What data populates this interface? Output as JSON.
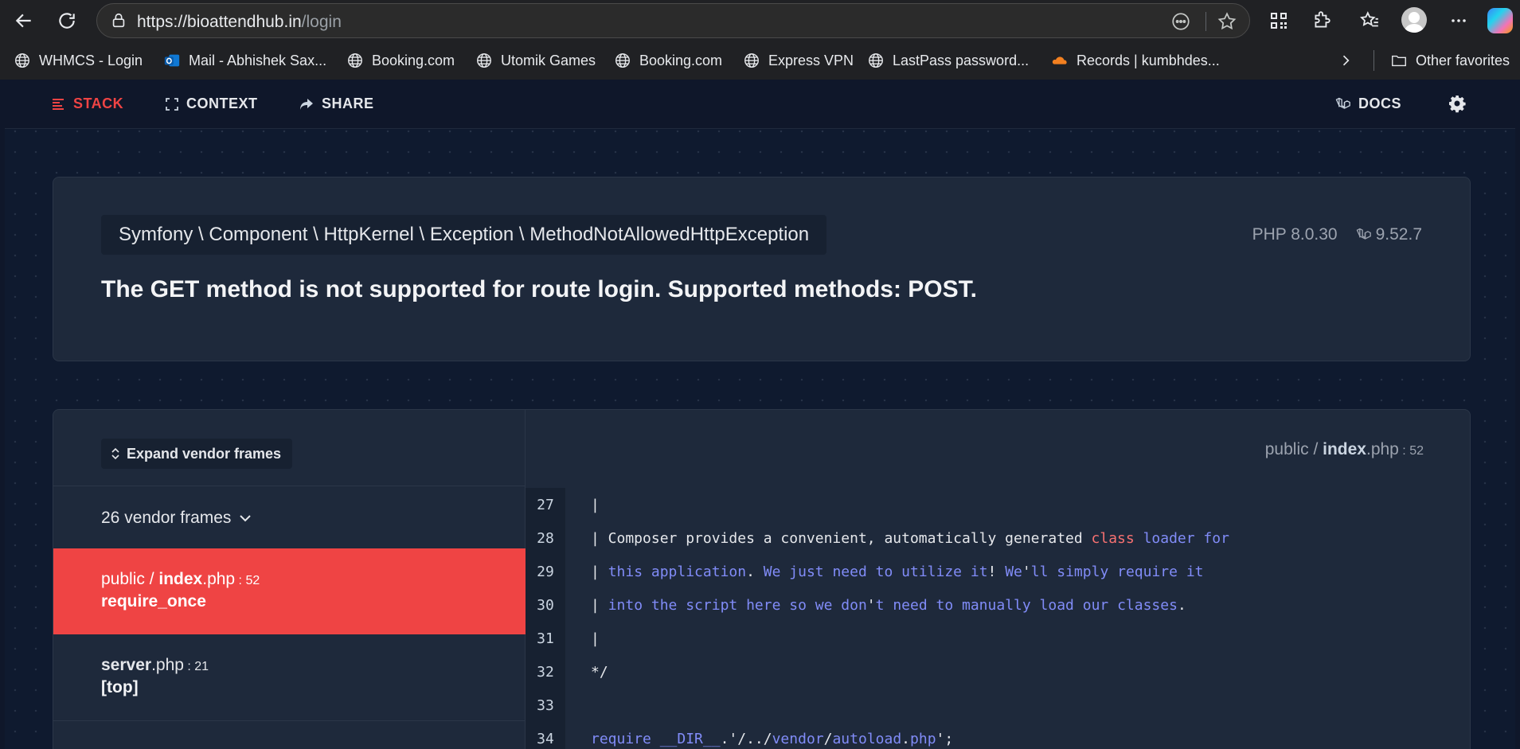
{
  "browser": {
    "url_host": "https://bioattendhub.in",
    "url_path": "/login",
    "bookmarks": [
      {
        "label": "WHMCS - Login",
        "icon": "globe-icon"
      },
      {
        "label": "Mail - Abhishek Sax...",
        "icon": "outlook-icon"
      },
      {
        "label": "Booking.com",
        "icon": "globe-icon"
      },
      {
        "label": "Utomik Games",
        "icon": "globe-icon"
      },
      {
        "label": "Booking.com",
        "icon": "globe-icon"
      },
      {
        "label": "Express VPN",
        "icon": "globe-icon"
      },
      {
        "label": "LastPass password...",
        "icon": "globe-icon"
      },
      {
        "label": "Records | kumbhdes...",
        "icon": "cloudflare-icon"
      }
    ],
    "other_favorites": "Other favorites"
  },
  "nav": {
    "stack": "STACK",
    "context": "CONTEXT",
    "share": "SHARE",
    "docs": "DOCS"
  },
  "exception": {
    "class": "Symfony \\ Component \\ HttpKernel \\ Exception \\ MethodNotAllowedHttpException",
    "message": "The GET method is not supported for route login. Supported methods: POST.",
    "php_version": "PHP 8.0.30",
    "laravel_version": "9.52.7"
  },
  "frames": {
    "expand_label": "Expand vendor frames",
    "vendor_count_label": "26 vendor frames",
    "items": [
      {
        "dir": "public / ",
        "file": "index",
        "ext": ".php",
        "line": " : 52",
        "fn": "require_once",
        "active": true
      },
      {
        "dir": "",
        "file": "server",
        "ext": ".php",
        "line": " : 21",
        "fn": "[top]",
        "active": false
      }
    ]
  },
  "code": {
    "file_dir": "public / ",
    "file_name": "index",
    "file_ext": ".php",
    "file_line": " : 52",
    "lines": [
      {
        "num": "27",
        "parts": [
          {
            "t": "|",
            "c": "white"
          }
        ]
      },
      {
        "num": "28",
        "parts": [
          {
            "t": "| Composer provides a convenient, automatically generated ",
            "c": "white"
          },
          {
            "t": "class",
            "c": "red"
          },
          {
            "t": " loader for",
            "c": "blue"
          }
        ]
      },
      {
        "num": "29",
        "parts": [
          {
            "t": "| ",
            "c": "white"
          },
          {
            "t": "this application",
            "c": "blue"
          },
          {
            "t": ". ",
            "c": "white"
          },
          {
            "t": "We just need to utilize it",
            "c": "blue"
          },
          {
            "t": "! ",
            "c": "white"
          },
          {
            "t": "We",
            "c": "blue"
          },
          {
            "t": "'",
            "c": "white"
          },
          {
            "t": "ll simply require it",
            "c": "blue"
          }
        ]
      },
      {
        "num": "30",
        "parts": [
          {
            "t": "| ",
            "c": "white"
          },
          {
            "t": "into the script here so we don",
            "c": "blue"
          },
          {
            "t": "'",
            "c": "white"
          },
          {
            "t": "t need to manually load our classes",
            "c": "blue"
          },
          {
            "t": ".",
            "c": "white"
          }
        ]
      },
      {
        "num": "31",
        "parts": [
          {
            "t": "|",
            "c": "white"
          }
        ]
      },
      {
        "num": "32",
        "parts": [
          {
            "t": "*/",
            "c": "white"
          }
        ]
      },
      {
        "num": "33",
        "parts": []
      },
      {
        "num": "34",
        "parts": [
          {
            "t": "require",
            "c": "blue"
          },
          {
            "t": " __DIR__",
            "c": "blue"
          },
          {
            "t": ".'/../",
            "c": "white"
          },
          {
            "t": "vendor",
            "c": "blue"
          },
          {
            "t": "/",
            "c": "white"
          },
          {
            "t": "autoload",
            "c": "blue"
          },
          {
            "t": ".",
            "c": "white"
          },
          {
            "t": "php",
            "c": "blue"
          },
          {
            "t": "';",
            "c": "white"
          }
        ]
      }
    ]
  },
  "colors": {
    "accent": "#ef4444",
    "code_blue": "#818cf8",
    "code_red": "#f87171",
    "page_bg": "#0f1a2f",
    "card_bg": "#1e293b"
  }
}
